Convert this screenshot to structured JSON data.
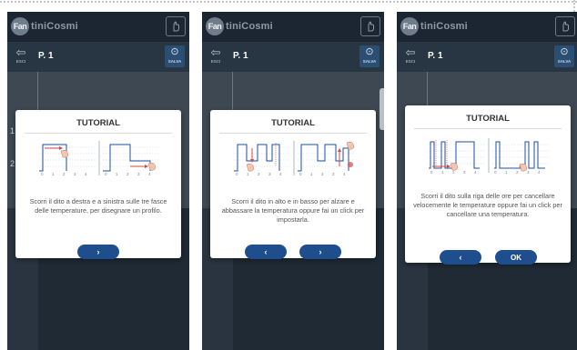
{
  "app": {
    "logo_badge": "Fan",
    "logo_text": "tiniCosmi"
  },
  "subheader": {
    "exit_label": "ESCI",
    "program": "P. 1",
    "save_label": "SALVA"
  },
  "row_numbers": [
    "1",
    "2"
  ],
  "colors": {
    "dark_bg": "#1d2a37",
    "primary_button": "#1f4e8f",
    "accent_red": "#d8443f",
    "chart_line": "#1e4fa0"
  },
  "icons": {
    "exit": "exit-icon",
    "save": "check-circle-icon",
    "topbar": "hand-icon",
    "next": "chevron-right-icon",
    "prev": "chevron-left-icon"
  },
  "axis_ticks": [
    "0",
    "1",
    "2",
    "3",
    "4"
  ],
  "screens": [
    {
      "title": "TUTORIAL",
      "text": "Scorri il dito a destra e a sinistra sulle tre fasce delle temperature, per disegnare un profilo.",
      "next_label": "›"
    },
    {
      "title": "TUTORIAL",
      "text": "Scorri il dito in alto e in basso per alzare e abbassare la temperatura oppure fai un click per impostarla.",
      "prev_label": "‹",
      "next_label": "›"
    },
    {
      "title": "TUTORIAL",
      "text": "Scorri il dito sulla riga delle ore per cancellare velocemente le temperature oppure fai un click per cancellare una temperatura.",
      "prev_label": "‹",
      "ok_label": "OK"
    }
  ]
}
